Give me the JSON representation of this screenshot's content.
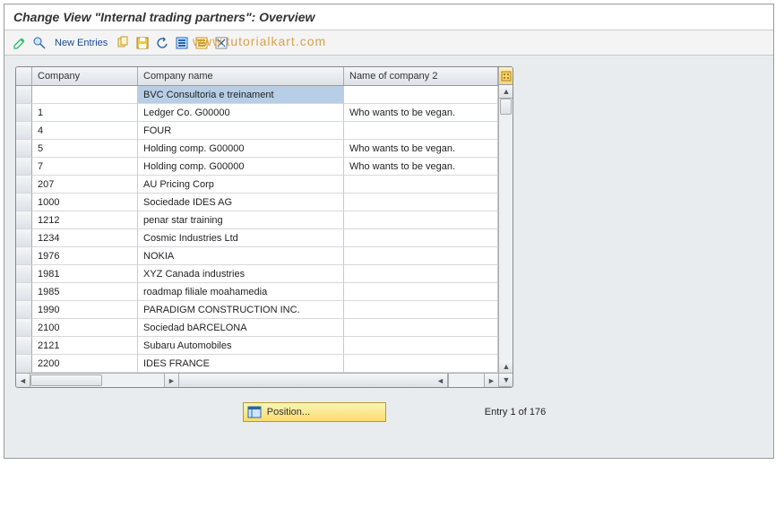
{
  "title": "Change View \"Internal trading partners\": Overview",
  "watermark": "www.tutorialkart.com",
  "toolbar": {
    "new_entries": "New Entries"
  },
  "table": {
    "columns": {
      "company": "Company",
      "company_name": "Company name",
      "name2": "Name of company 2"
    },
    "rows": [
      {
        "company": "",
        "name": "BVC Consultoria e treinament",
        "name2": "",
        "selected": true
      },
      {
        "company": "1",
        "name": "Ledger Co. G00000",
        "name2": "Who wants to be vegan."
      },
      {
        "company": "4",
        "name": "FOUR",
        "name2": ""
      },
      {
        "company": "5",
        "name": "Holding comp. G00000",
        "name2": "Who wants to be vegan."
      },
      {
        "company": "7",
        "name": "Holding comp. G00000",
        "name2": "Who wants to be vegan."
      },
      {
        "company": "207",
        "name": "AU Pricing Corp",
        "name2": ""
      },
      {
        "company": "1000",
        "name": "Sociedade IDES AG",
        "name2": ""
      },
      {
        "company": "1212",
        "name": "penar star training",
        "name2": ""
      },
      {
        "company": "1234",
        "name": "Cosmic Industries Ltd",
        "name2": ""
      },
      {
        "company": "1976",
        "name": "NOKIA",
        "name2": ""
      },
      {
        "company": "1981",
        "name": "XYZ Canada industries",
        "name2": ""
      },
      {
        "company": "1985",
        "name": "roadmap filiale moahamedia",
        "name2": ""
      },
      {
        "company": "1990",
        "name": "PARADIGM CONSTRUCTION INC.",
        "name2": ""
      },
      {
        "company": "2100",
        "name": "Sociedad bARCELONA",
        "name2": ""
      },
      {
        "company": "2121",
        "name": "Subaru Automobiles",
        "name2": ""
      },
      {
        "company": "2200",
        "name": "IDES FRANCE",
        "name2": ""
      }
    ]
  },
  "footer": {
    "position_label": "Position...",
    "entry_text": "Entry 1 of 176"
  }
}
